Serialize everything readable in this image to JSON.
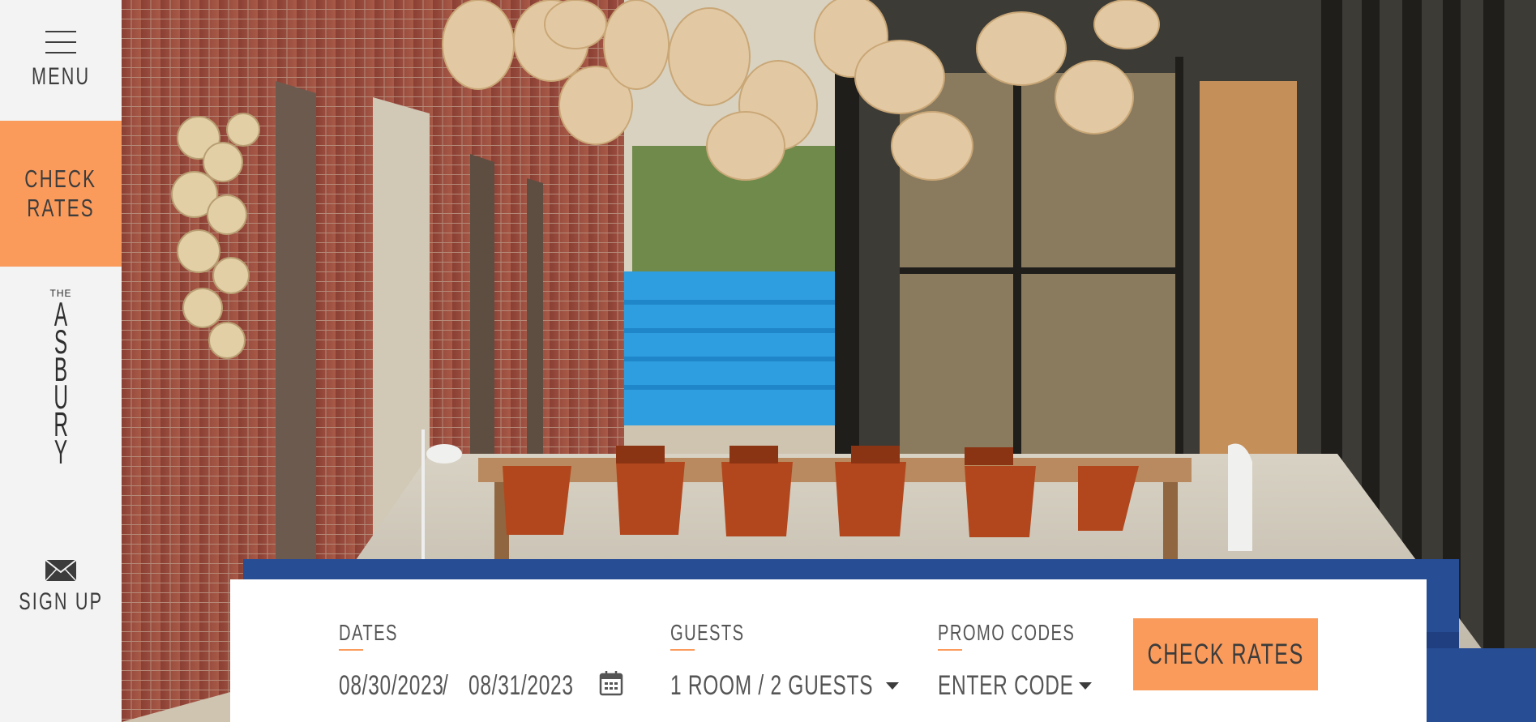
{
  "sidebar": {
    "menu_label": "MENU",
    "check_rates_line1": "CHECK",
    "check_rates_line2": "RATES",
    "logo_the": "THE",
    "logo_letters": [
      "A",
      "S",
      "B",
      "U",
      "R",
      "Y"
    ],
    "signup_label": "SIGN UP",
    "accent_color": "#fa9b5c"
  },
  "hero": {
    "icons": [
      "hamburger-icon",
      "envelope-icon",
      "calendar-icon",
      "chevron-down-icon"
    ]
  },
  "booking": {
    "dates_label": "DATES",
    "check_in": "08/30/2023",
    "separator": "/",
    "check_out": "08/31/2023",
    "guests_label": "GUESTS",
    "guests_value": "1 ROOM / 2 GUESTS",
    "promo_label": "PROMO CODES",
    "promo_placeholder": "ENTER CODE",
    "cta_label": "CHECK RATES"
  }
}
